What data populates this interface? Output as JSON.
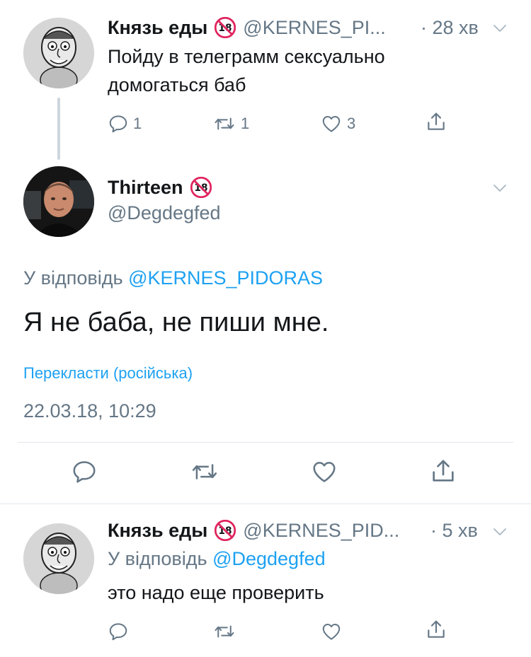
{
  "tweet1": {
    "name": "Князь еды",
    "handle": "@KERNES_PI...",
    "time": "· 28 хв",
    "text": "Пойду в телеграмм сексуально домогаться баб",
    "replies": "1",
    "retweets": "1",
    "likes": "3"
  },
  "main": {
    "name": "Thirteen",
    "handle": "@Degdegfed",
    "reply_prefix": "У відповідь",
    "reply_to": "@KERNES_PIDORAS",
    "text": "Я не баба, не пиши мне.",
    "translate": "Перекласти (російська)",
    "timestamp": "22.03.18, 10:29"
  },
  "tweet3": {
    "name": "Князь еды",
    "handle": "@KERNES_PID...",
    "time": "· 5 хв",
    "reply_prefix": "У відповідь",
    "reply_to": "@Degdegfed",
    "text": "это надо еще проверить"
  },
  "colors": {
    "accent": "#1da1f2",
    "secondary_text": "#657786",
    "divider": "#e1e8ed",
    "badge_red": "#e0245e"
  },
  "icons": [
    "reply-icon",
    "retweet-icon",
    "like-icon",
    "share-icon",
    "chevron-down-icon",
    "age-18-badge-icon"
  ]
}
